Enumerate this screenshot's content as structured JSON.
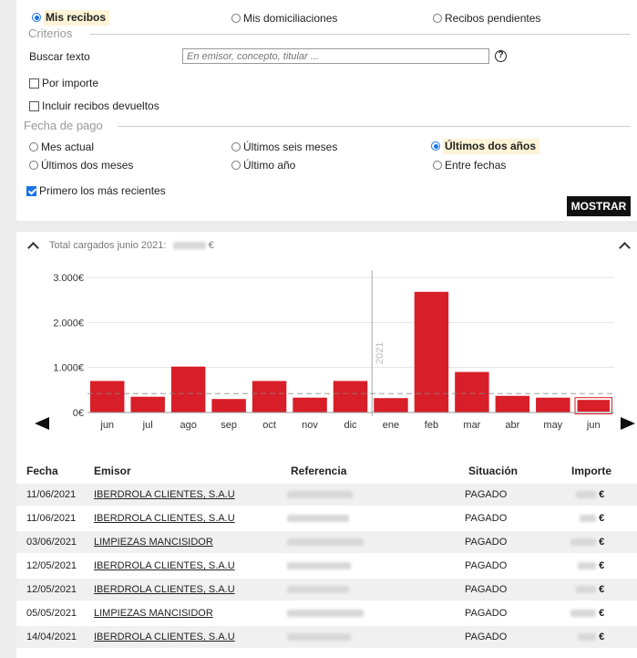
{
  "receipt_type": {
    "options": [
      {
        "label": "Mis recibos",
        "selected": true
      },
      {
        "label": "Mis domiciliaciones",
        "selected": false
      },
      {
        "label": "Recibos pendientes",
        "selected": false
      }
    ]
  },
  "criteria": {
    "title": "Criterios",
    "search_label": "Buscar texto",
    "search_placeholder": "En emisor, concepto, titular ...",
    "help_glyph": "?",
    "by_amount": "Por importe",
    "include_returned": "Incluir recibos devueltos"
  },
  "payment_date": {
    "title": "Fecha de pago",
    "options": [
      {
        "label": "Mes actual",
        "selected": false
      },
      {
        "label": "Últimos seis meses",
        "selected": false
      },
      {
        "label": "Últimos dos años",
        "selected": true
      },
      {
        "label": "Últimos dos meses",
        "selected": false
      },
      {
        "label": "Último año",
        "selected": false
      },
      {
        "label": "Entre fechas",
        "selected": false
      }
    ],
    "most_recent_first": "Primero los más recientes",
    "most_recent_checked": true
  },
  "show_button": "MOSTRAR",
  "summary": {
    "label": "Total cargados junio 2021:",
    "currency": "€"
  },
  "chart_data": {
    "type": "bar",
    "categories": [
      "jun",
      "jul",
      "ago",
      "sep",
      "oct",
      "nov",
      "dic",
      "ene",
      "feb",
      "mar",
      "abr",
      "may",
      "jun"
    ],
    "values": [
      700,
      350,
      1020,
      300,
      700,
      330,
      700,
      320,
      2680,
      900,
      370,
      330,
      300
    ],
    "ylim": [
      0,
      3000
    ],
    "yticks": [
      "0€",
      "1.000€",
      "2.000€",
      "3.000€"
    ],
    "average_line": 420,
    "year_marker": "2021",
    "bar_color": "#d81e28",
    "selected_index": 12
  },
  "table": {
    "headers": {
      "fecha": "Fecha",
      "emisor": "Emisor",
      "referencia": "Referencia",
      "situacion": "Situación",
      "importe": "Importe"
    },
    "rows": [
      {
        "fecha": "11/06/2021",
        "emisor": "IBERDROLA CLIENTES, S.A.U",
        "situacion": "PAGADO",
        "currency": "€"
      },
      {
        "fecha": "11/06/2021",
        "emisor": "IBERDROLA CLIENTES, S.A.U",
        "situacion": "PAGADO",
        "currency": "€"
      },
      {
        "fecha": "03/06/2021",
        "emisor": "LIMPIEZAS MANCISIDOR",
        "situacion": "PAGADO",
        "currency": "€"
      },
      {
        "fecha": "12/05/2021",
        "emisor": "IBERDROLA CLIENTES, S.A.U",
        "situacion": "PAGADO",
        "currency": "€"
      },
      {
        "fecha": "12/05/2021",
        "emisor": "IBERDROLA CLIENTES, S.A.U",
        "situacion": "PAGADO",
        "currency": "€"
      },
      {
        "fecha": "05/05/2021",
        "emisor": "LIMPIEZAS MANCISIDOR",
        "situacion": "PAGADO",
        "currency": "€"
      },
      {
        "fecha": "14/04/2021",
        "emisor": "IBERDROLA CLIENTES, S.A.U",
        "situacion": "PAGADO",
        "currency": "€"
      }
    ]
  }
}
